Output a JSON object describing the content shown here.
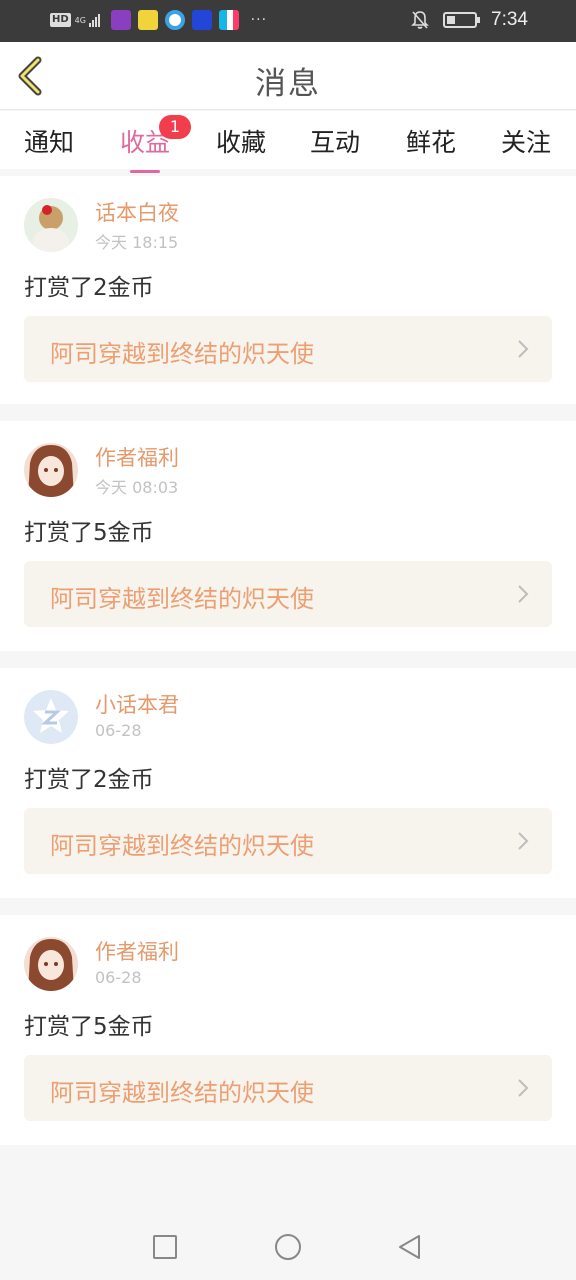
{
  "status_bar": {
    "hd": "HD",
    "network": "4G",
    "time": "7:34",
    "icons": [
      "signal-icon",
      "app-icon-purple",
      "app-icon-yellow",
      "app-icon-blue",
      "app-icon-flash",
      "app-icon-video",
      "bell-off-icon",
      "battery-icon"
    ]
  },
  "header": {
    "title": "消息",
    "back_icon": "chevron-left-icon"
  },
  "tabs": [
    {
      "label": "通知"
    },
    {
      "label": "收益",
      "badge": "1"
    },
    {
      "label": "收藏"
    },
    {
      "label": "互动"
    },
    {
      "label": "鲜花"
    },
    {
      "label": "关注"
    }
  ],
  "messages": [
    {
      "user": "话本白夜",
      "time": "今天 18:15",
      "text": "打赏了2金币",
      "work": "阿司穿越到终结的炽天使"
    },
    {
      "user": "作者福利",
      "time": "今天 08:03",
      "text": "打赏了5金币",
      "work": "阿司穿越到终结的炽天使"
    },
    {
      "user": "小话本君",
      "time": "06-28",
      "text": "打赏了2金币",
      "work": "阿司穿越到终结的炽天使"
    },
    {
      "user": "作者福利",
      "time": "06-28",
      "text": "打赏了5金币",
      "work": "阿司穿越到终结的炽天使"
    }
  ],
  "colors": {
    "accent": "#e06a9e",
    "username": "#e59a6c",
    "link": "#ed9f74",
    "badge": "#f23d4d"
  },
  "nav_icons": [
    "square-icon",
    "circle-icon",
    "back-triangle-icon"
  ]
}
